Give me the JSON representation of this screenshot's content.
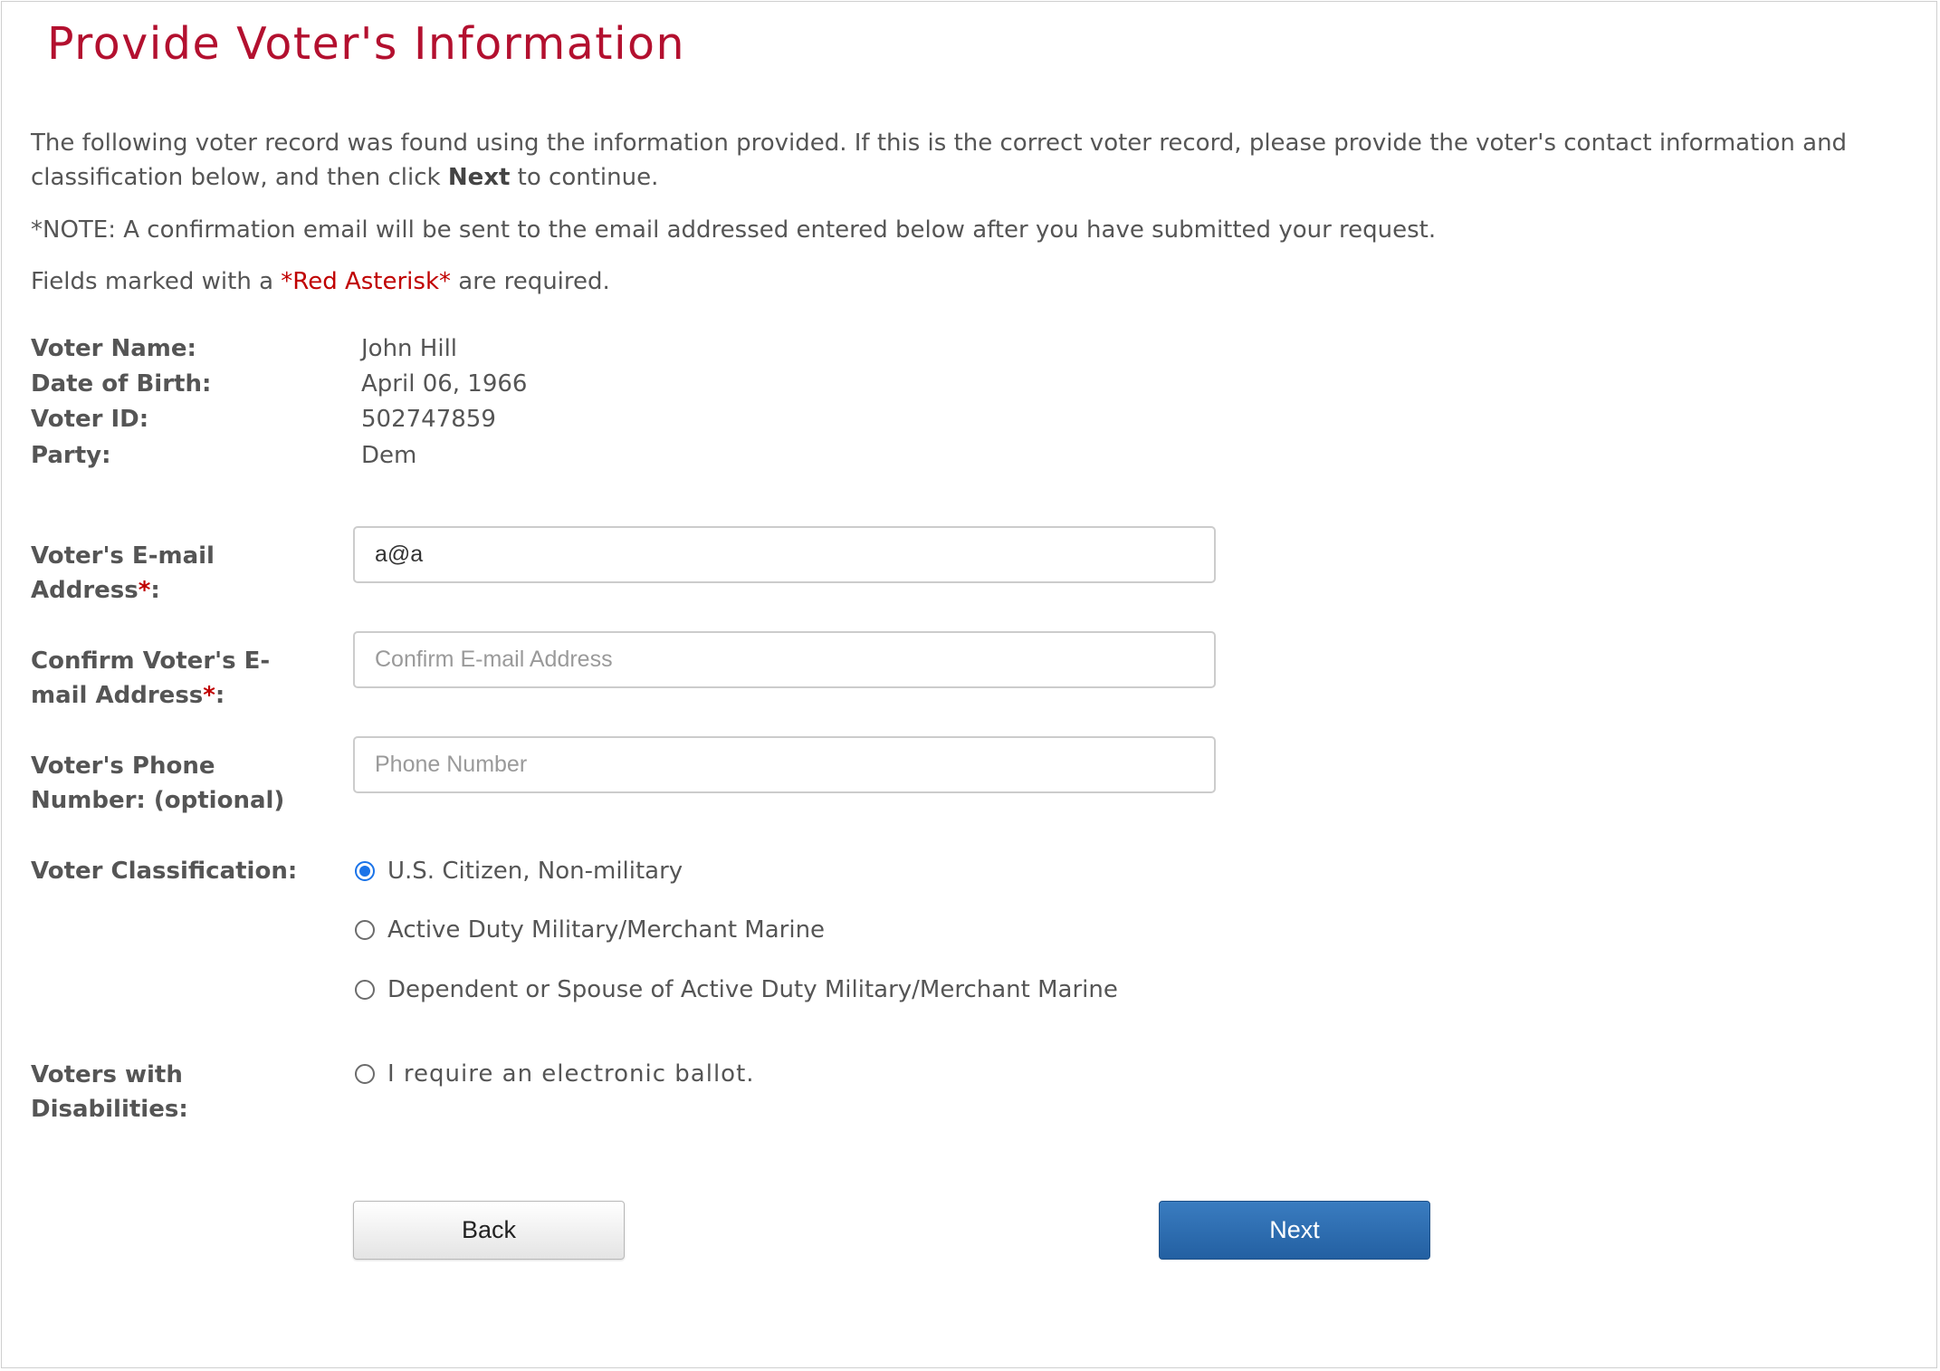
{
  "page": {
    "title": "Provide Voter's Information",
    "intro_part1": "The following voter record was found using the information provided. If this is the correct voter record, please provide the voter's contact information and classification below, and then click ",
    "intro_bold": "Next",
    "intro_part2": " to continue.",
    "note": "*NOTE: A confirmation email will be sent to the email addressed entered below after you have submitted your request.",
    "required_prefix": "Fields marked with a ",
    "required_highlight": "*Red Asterisk*",
    "required_suffix": " are required."
  },
  "voter": {
    "name_label": "Voter Name:",
    "name_value": "John Hill",
    "dob_label": "Date of Birth:",
    "dob_value": "April 06, 1966",
    "id_label": "Voter ID:",
    "id_value": "502747859",
    "party_label": "Party:",
    "party_value": "Dem"
  },
  "form": {
    "email_label": "Voter's E-mail Address",
    "email_value": "a@a",
    "confirm_label": "Confirm Voter's E-mail Address",
    "confirm_placeholder": "Confirm E-mail Address",
    "phone_label": "Voter's Phone Number: (optional)",
    "phone_placeholder": "Phone Number",
    "required_mark": "*",
    "colon": ":",
    "classification_label": "Voter Classification:",
    "classification_options": [
      "U.S. Citizen, Non-military",
      "Active Duty Military/Merchant Marine",
      "Dependent or Spouse of Active Duty Military/Merchant Marine"
    ],
    "classification_selected": "U.S. Citizen, Non-military",
    "disabilities_label": "Voters with Disabilities:",
    "disabilities_option": "I require an electronic ballot."
  },
  "buttons": {
    "back": "Back",
    "next": "Next"
  },
  "colors": {
    "title": "#b3102f",
    "required": "#c00000",
    "primary_button": "#2a67a8",
    "radio_selected": "#1a73e8"
  }
}
